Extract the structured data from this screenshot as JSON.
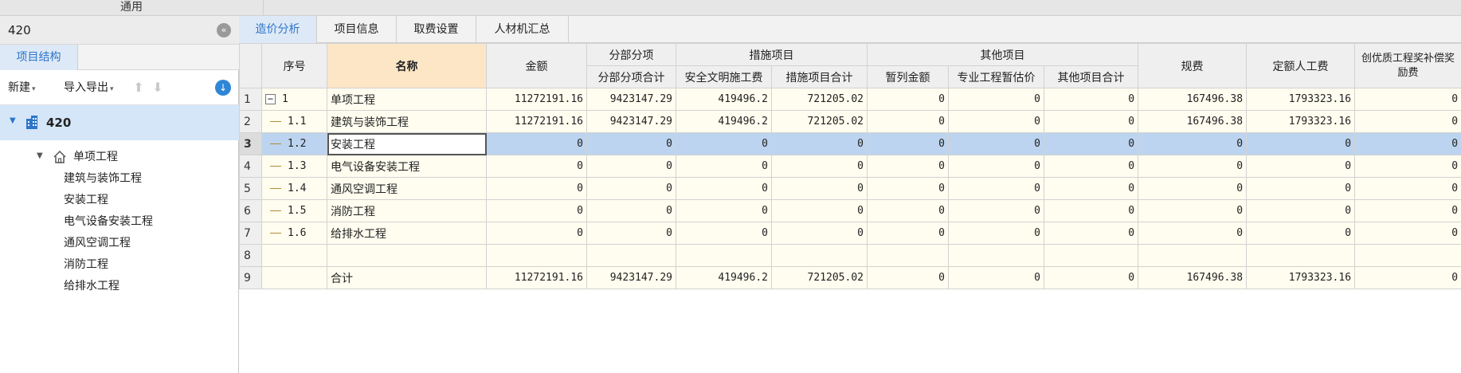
{
  "topbar": {
    "title": "通用"
  },
  "left": {
    "project_name": "420",
    "tab": "项目结构",
    "toolbar": {
      "new": "新建",
      "import_export": "导入导出"
    },
    "tree": {
      "root": "420",
      "node": "单项工程",
      "leaves": [
        "建筑与装饰工程",
        "安装工程",
        "电气设备安装工程",
        "通风空调工程",
        "消防工程",
        "给排水工程"
      ]
    }
  },
  "tabs": [
    "造价分析",
    "项目信息",
    "取费设置",
    "人材机汇总"
  ],
  "table": {
    "headers": {
      "seq": "序号",
      "name": "名称",
      "amount": "金额",
      "fbfx": "分部分项",
      "fbfx_total": "分部分项合计",
      "csxm": "措施项目",
      "aqwm": "安全文明施工费",
      "csxm_total": "措施项目合计",
      "qtxm": "其他项目",
      "zlje": "暂列金额",
      "zygc": "专业工程暂估价",
      "qtxm_total": "其他项目合计",
      "gf": "规费",
      "deg": "定额人工费",
      "cy": "创优质工程奖补偿奖励费"
    },
    "rows": [
      {
        "rn": "1",
        "seq": "1",
        "name": "单项工程",
        "amount": "11272191.16",
        "fbfx": "9423147.29",
        "aqwm": "419496.2",
        "cs": "721205.02",
        "zl": "0",
        "zy": "0",
        "qt": "0",
        "gf": "167496.38",
        "de": "1793323.16",
        "cy": "0"
      },
      {
        "rn": "2",
        "seq": "1.1",
        "name": "建筑与装饰工程",
        "amount": "11272191.16",
        "fbfx": "9423147.29",
        "aqwm": "419496.2",
        "cs": "721205.02",
        "zl": "0",
        "zy": "0",
        "qt": "0",
        "gf": "167496.38",
        "de": "1793323.16",
        "cy": "0"
      },
      {
        "rn": "3",
        "seq": "1.2",
        "name": "安装工程",
        "amount": "0",
        "fbfx": "0",
        "aqwm": "0",
        "cs": "0",
        "zl": "0",
        "zy": "0",
        "qt": "0",
        "gf": "0",
        "de": "0",
        "cy": "0"
      },
      {
        "rn": "4",
        "seq": "1.3",
        "name": "电气设备安装工程",
        "amount": "0",
        "fbfx": "0",
        "aqwm": "0",
        "cs": "0",
        "zl": "0",
        "zy": "0",
        "qt": "0",
        "gf": "0",
        "de": "0",
        "cy": "0"
      },
      {
        "rn": "5",
        "seq": "1.4",
        "name": "通风空调工程",
        "amount": "0",
        "fbfx": "0",
        "aqwm": "0",
        "cs": "0",
        "zl": "0",
        "zy": "0",
        "qt": "0",
        "gf": "0",
        "de": "0",
        "cy": "0"
      },
      {
        "rn": "6",
        "seq": "1.5",
        "name": "消防工程",
        "amount": "0",
        "fbfx": "0",
        "aqwm": "0",
        "cs": "0",
        "zl": "0",
        "zy": "0",
        "qt": "0",
        "gf": "0",
        "de": "0",
        "cy": "0"
      },
      {
        "rn": "7",
        "seq": "1.6",
        "name": "给排水工程",
        "amount": "0",
        "fbfx": "0",
        "aqwm": "0",
        "cs": "0",
        "zl": "0",
        "zy": "0",
        "qt": "0",
        "gf": "0",
        "de": "0",
        "cy": "0"
      },
      {
        "rn": "8",
        "seq": "",
        "name": "",
        "amount": "",
        "fbfx": "",
        "aqwm": "",
        "cs": "",
        "zl": "",
        "zy": "",
        "qt": "",
        "gf": "",
        "de": "",
        "cy": ""
      },
      {
        "rn": "9",
        "seq": "",
        "name": "合计",
        "amount": "11272191.16",
        "fbfx": "9423147.29",
        "aqwm": "419496.2",
        "cs": "721205.02",
        "zl": "0",
        "zy": "0",
        "qt": "0",
        "gf": "167496.38",
        "de": "1793323.16",
        "cy": "0"
      }
    ]
  },
  "colors": {
    "accent": "#2e75c9",
    "selected_row": "#bcd4ef",
    "name_header": "#fde6c6",
    "cell_bg": "#fffdef"
  }
}
